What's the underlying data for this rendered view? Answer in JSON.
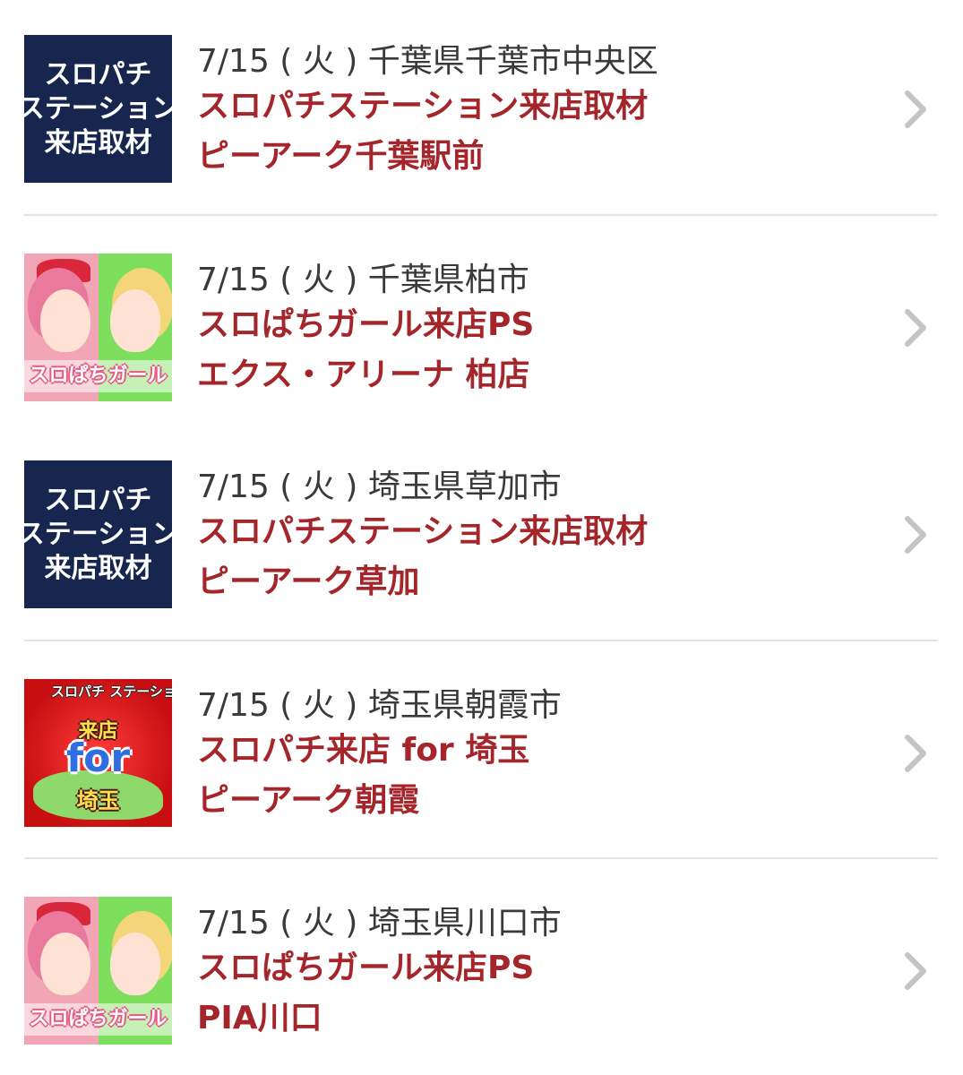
{
  "events": [
    {
      "date": "7/15 ( 火 ) 千葉県千葉市中央区",
      "title": "スロパチステーション来店取材",
      "shop": "ピーアーク千葉駅前",
      "thumb_type": "station",
      "thumb_lines": [
        "スロパチ",
        "ステーション",
        "来店取材"
      ]
    },
    {
      "date": "7/15 ( 火 ) 千葉県柏市",
      "title": "スロぱちガール来店PS",
      "shop": "エクス・アリーナ 柏店",
      "thumb_type": "girl",
      "thumb_label": "スロぱちガール"
    },
    {
      "date": "7/15 ( 火 ) 埼玉県草加市",
      "title": "スロパチステーション来店取材",
      "shop": "ピーアーク草加",
      "thumb_type": "station",
      "thumb_lines": [
        "スロパチ",
        "ステーション",
        "来店取材"
      ]
    },
    {
      "date": "7/15 ( 火 ) 埼玉県朝霞市",
      "title": "スロパチ来店 for 埼玉",
      "shop": "ピーアーク朝霞",
      "thumb_type": "saitama",
      "thumb_top": "スロパチ ステーション",
      "thumb_mid": "来店",
      "thumb_for": "for",
      "thumb_pref": "埼玉"
    },
    {
      "date": "7/15 ( 火 ) 埼玉県川口市",
      "title": "スロぱちガール来店PS",
      "shop": "PIA川口",
      "thumb_type": "girl",
      "thumb_label": "スロぱちガール"
    }
  ],
  "colors": {
    "title": "#a4252a",
    "date": "#3a3a3a",
    "navy": "#16264f",
    "divider": "#e3e3e3",
    "chevron": "#c4c4c4"
  },
  "icons": {
    "row_arrow": "chevron-right-icon"
  }
}
